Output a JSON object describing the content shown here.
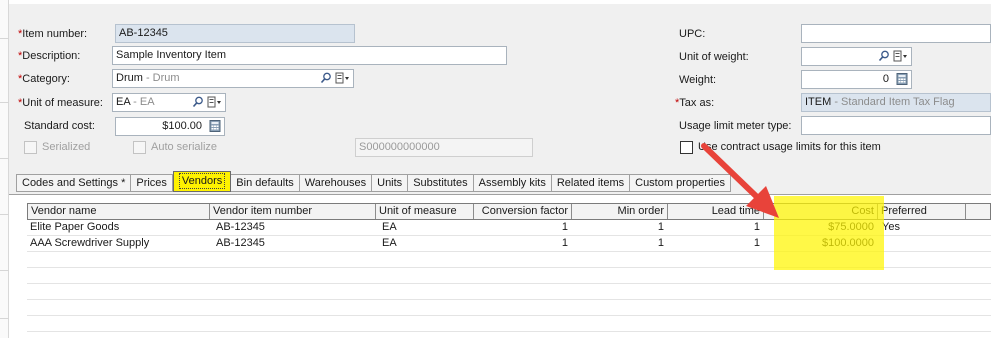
{
  "form": {
    "item_number": {
      "label": "Item number:",
      "value": "AB-12345"
    },
    "description": {
      "label": "Description:",
      "value": "Sample Inventory Item"
    },
    "category": {
      "label": "Category:",
      "code": "Drum",
      "desc": " - Drum"
    },
    "unit_of_measure": {
      "label": "Unit of measure:",
      "code": "EA",
      "desc": " - EA"
    },
    "standard_cost": {
      "label": "Standard cost:",
      "value": "$100.00"
    },
    "serialized": {
      "label": "Serialized"
    },
    "auto_serialize": {
      "label": "Auto serialize"
    },
    "serial_value": "S000000000000",
    "upc": {
      "label": "UPC:",
      "value": ""
    },
    "unit_of_weight": {
      "label": "Unit of weight:",
      "value": ""
    },
    "weight": {
      "label": "Weight:",
      "value": "0"
    },
    "tax_as": {
      "label": "Tax as:",
      "code": "ITEM",
      "desc": " - Standard Item Tax Flag"
    },
    "usage_limit": {
      "label": "Usage limit meter type:",
      "value": ""
    },
    "use_contract": {
      "label": "Use contract usage limits for this item"
    },
    "required_mark": "*"
  },
  "tabs": [
    {
      "label": "Codes and Settings *"
    },
    {
      "label": "Prices"
    },
    {
      "label": "Vendors"
    },
    {
      "label": "Bin defaults"
    },
    {
      "label": "Warehouses"
    },
    {
      "label": "Units"
    },
    {
      "label": "Substitutes"
    },
    {
      "label": "Assembly kits"
    },
    {
      "label": "Related items"
    },
    {
      "label": "Custom properties"
    }
  ],
  "grid": {
    "columns": [
      "Vendor name",
      "Vendor item number",
      "Unit of measure",
      "Conversion factor",
      "Min order",
      "Lead time",
      "Cost",
      "Preferred"
    ],
    "rows": [
      [
        "Elite Paper Goods",
        "AB-12345",
        "EA",
        "1",
        "1",
        "1",
        "$75.0000",
        "Yes"
      ],
      [
        "AAA Screwdriver Supply",
        "AB-12345",
        "EA",
        "1",
        "1",
        "1",
        "$100.0000",
        ""
      ]
    ]
  },
  "annotation": {
    "highlight_color": "#fff200",
    "arrow_color": "#e8433a"
  }
}
